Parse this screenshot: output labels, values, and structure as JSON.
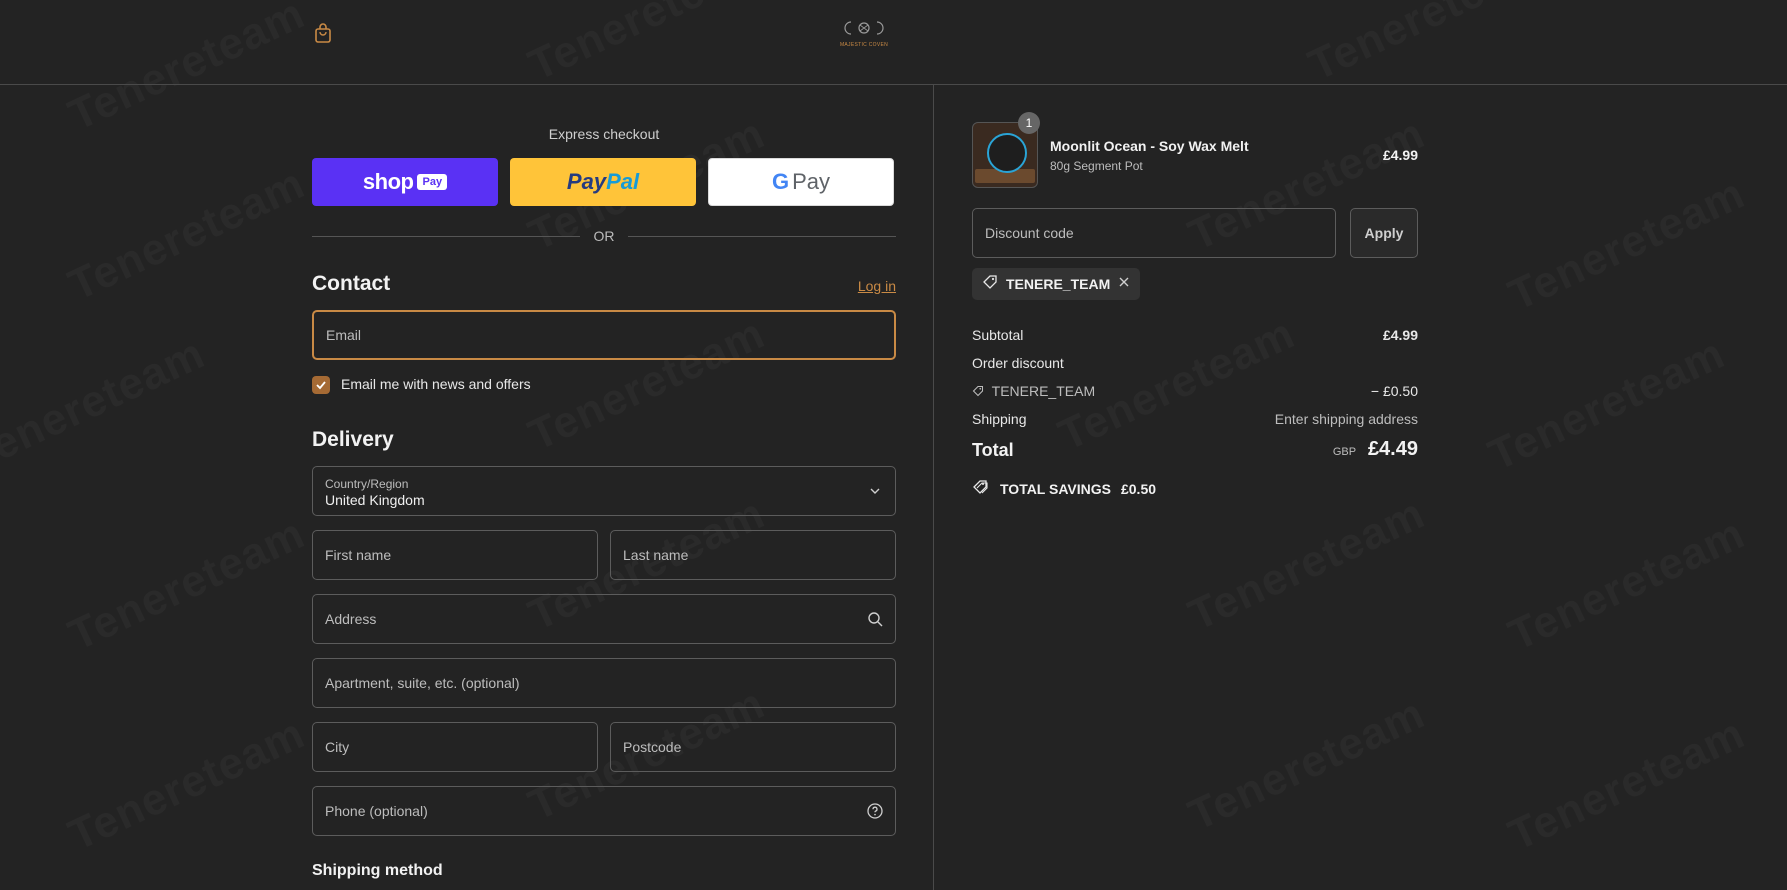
{
  "header": {
    "logo_text": "MAJESTIC COVEN",
    "cart_icon": "shopping-bag-icon"
  },
  "express": {
    "title": "Express checkout",
    "shop_word": "shop",
    "shop_pay": "Pay",
    "paypal_a": "Pay",
    "paypal_b": "Pal",
    "gpay_g": "G",
    "gpay_word": "Pay",
    "or": "OR"
  },
  "contact": {
    "heading": "Contact",
    "login": "Log in",
    "email_placeholder": "Email",
    "newsletter_label": "Email me with news and offers",
    "newsletter_checked": true
  },
  "delivery": {
    "heading": "Delivery",
    "country_label": "Country/Region",
    "country_value": "United Kingdom",
    "first_name": "First name",
    "last_name": "Last name",
    "address": "Address",
    "apartment": "Apartment, suite, etc. (optional)",
    "city": "City",
    "postcode": "Postcode",
    "phone": "Phone (optional)"
  },
  "shipping_method": {
    "heading": "Shipping method"
  },
  "order": {
    "item": {
      "name": "Moonlit Ocean - Soy Wax Melt",
      "variant": "80g Segment Pot",
      "price": "£4.99",
      "quantity": "1"
    },
    "discount_placeholder": "Discount code",
    "apply": "Apply",
    "applied_code": "TENERE_TEAM",
    "subtotal_label": "Subtotal",
    "subtotal_value": "£4.99",
    "order_discount_label": "Order discount",
    "discount_code_line": "TENERE_TEAM",
    "discount_value": "− £0.50",
    "shipping_label": "Shipping",
    "shipping_value": "Enter shipping address",
    "total_label": "Total",
    "currency": "GBP",
    "total_value": "£4.49",
    "savings_label": "TOTAL SAVINGS",
    "savings_value": "£0.50"
  },
  "colors": {
    "background": "#232323",
    "accent": "#c98a45",
    "shop_pay": "#5a31f4",
    "paypal": "#ffc439"
  }
}
